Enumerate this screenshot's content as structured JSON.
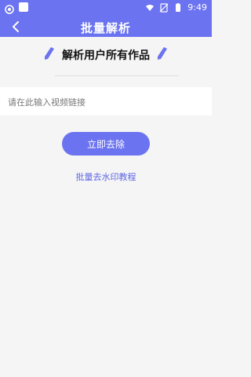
{
  "status_bar": {
    "time": "9:49",
    "icons": [
      "app-icon",
      "square-icon",
      "wifi-icon",
      "no-sim-icon",
      "battery-icon"
    ]
  },
  "header": {
    "title": "批量解析",
    "back_icon": "back-arrow-icon",
    "bg_color": "#6b73f0"
  },
  "section": {
    "title": "解析用户所有作品",
    "icons": [
      "pencil-icon",
      "pencil-icon"
    ]
  },
  "input": {
    "placeholder": "请在此输入视频链接",
    "value": ""
  },
  "actions": {
    "primary_label": "立即去除",
    "tutorial_label": "批量去水印教程",
    "accent_color": "#6b73f0",
    "link_color": "#5f67e6"
  }
}
